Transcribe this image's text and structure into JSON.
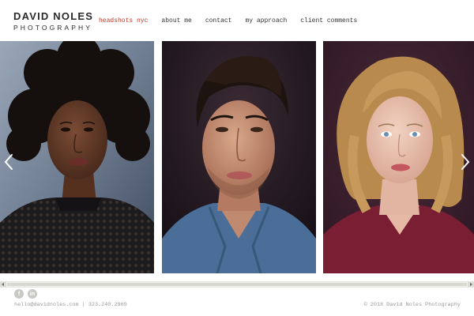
{
  "brand": {
    "name": "DAVID NOLES",
    "subtitle": "PHOTOGRAPHY"
  },
  "nav": {
    "items": [
      {
        "label": "headshots nyc",
        "active": true
      },
      {
        "label": "about me",
        "active": false
      },
      {
        "label": "contact",
        "active": false
      },
      {
        "label": "my approach",
        "active": false
      },
      {
        "label": "client comments",
        "active": false
      }
    ]
  },
  "gallery": {
    "photos": [
      {
        "subject": "woman-curly-hair",
        "background": "#7f8fa6"
      },
      {
        "subject": "man-dark-hair",
        "background": "#241826"
      },
      {
        "subject": "woman-blonde-hair",
        "background": "#3a1f2e"
      }
    ],
    "prev_icon": "chevron-left-icon",
    "next_icon": "chevron-right-icon"
  },
  "social": {
    "facebook": "f",
    "linkedin": "in"
  },
  "footer": {
    "contact": "hello@davidnoles.com | 323.240.2969",
    "copyright": "© 2018 David Noles Photography"
  },
  "colors": {
    "accent": "#c0392b",
    "text": "#333333",
    "muted": "#999999"
  }
}
